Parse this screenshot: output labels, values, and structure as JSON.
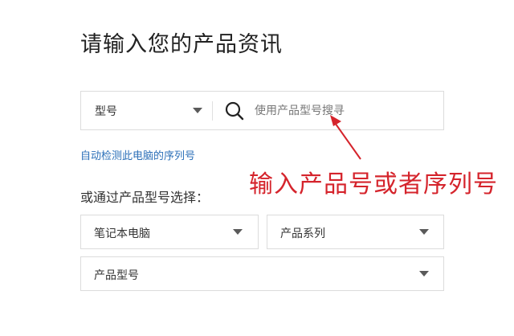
{
  "page": {
    "title": "请输入您的产品资讯"
  },
  "search": {
    "type_selected": "型号",
    "placeholder": "使用产品型号搜寻"
  },
  "auto_detect_link": "自动检测此电脑的序列号",
  "annotation": {
    "text": "输入产品号或者序列号",
    "color": "#d5242c"
  },
  "select_prompt": "或通过产品型号选择：",
  "dropdowns": {
    "category": "笔记本电脑",
    "series": "产品系列",
    "model": "产品型号"
  },
  "colors": {
    "link": "#2b6fb8",
    "annotation": "#d5242c",
    "border": "#dcdcdc"
  }
}
